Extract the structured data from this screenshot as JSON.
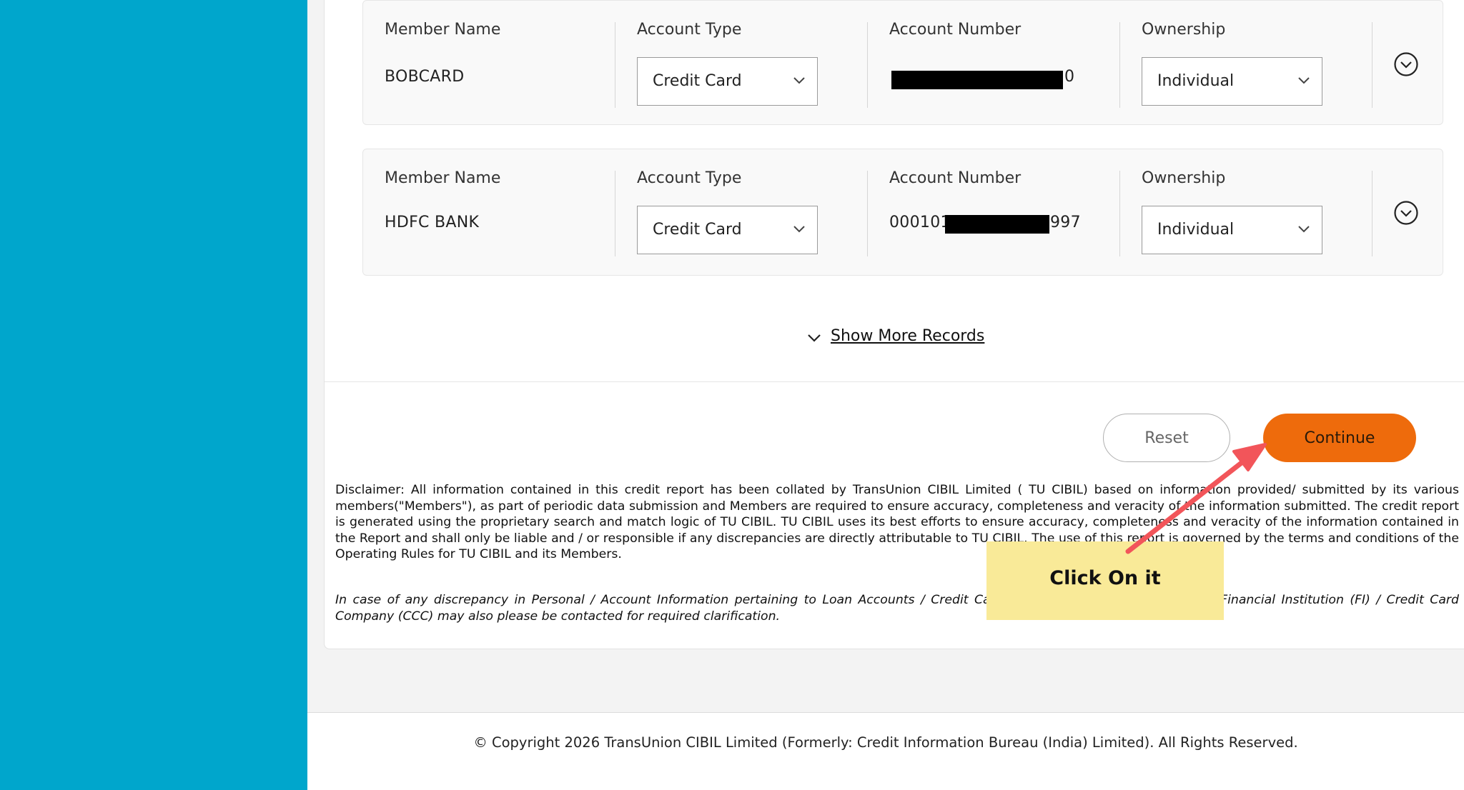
{
  "records": [
    {
      "member_label": "Member Name",
      "member_value": "BOBCARD",
      "account_type_label": "Account Type",
      "account_type_value": "Credit Card",
      "account_number_label": "Account Number",
      "account_number_suffix": "0",
      "ownership_label": "Ownership",
      "ownership_value": "Individual"
    },
    {
      "member_label": "Member Name",
      "member_value": "HDFC BANK",
      "account_type_label": "Account Type",
      "account_type_value": "Credit Card",
      "account_number_label": "Account Number",
      "account_number_prefix": "000101",
      "account_number_suffix": "997",
      "ownership_label": "Ownership",
      "ownership_value": "Individual"
    }
  ],
  "show_more_label": "Show More Records",
  "buttons": {
    "reset": "Reset",
    "continue": "Continue"
  },
  "disclaimer": "Disclaimer: All information contained in this credit report has been collated by TransUnion CIBIL Limited ( TU CIBIL) based on information provided/ submitted by its various members(\"Members\"), as part of periodic data submission and Members are required to ensure accuracy, completeness and veracity of the information submitted. The credit report is generated using the proprietary search and match logic of TU CIBIL. TU CIBIL uses its best efforts to ensure accuracy, completeness and veracity of the information contained in the Report and shall only be liable and / or responsible if any discrepancies are directly attributable to TU CIBIL. The use of this report is governed by the terms and conditions of the Operating Rules for TU CIBIL and its Members.",
  "note": "In case of any discrepancy in Personal / Account Information pertaining to Loan Accounts / Credit Card Accounts, the concerned Bank / Financial Institution (FI) / Credit Card Company (CCC) may also please be contacted for required clarification.",
  "footer": "© Copyright 2026 TransUnion CIBIL Limited (Formerly: Credit Information Bureau (India) Limited). All Rights Reserved.",
  "annotation": {
    "text": "Click On it",
    "arrow_color": "#f2555a"
  },
  "colors": {
    "sidebar": "#00a6cc",
    "continue": "#ee6b0c",
    "callout": "#f9ea98"
  }
}
